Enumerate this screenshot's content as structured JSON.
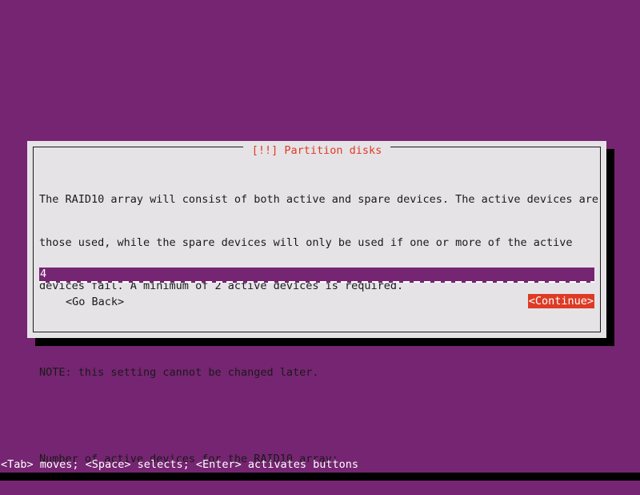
{
  "screen": {
    "background_color": "#762572",
    "accent_color": "#dd3b25",
    "dialog_bg_color": "#e6e3e7",
    "text_color": "#1a1a1a",
    "input_bg_color": "#762572",
    "input_text_color": "#ffffff"
  },
  "dialog": {
    "title": "[!!] Partition disks",
    "body_lines": [
      "The RAID10 array will consist of both active and spare devices. The active devices are",
      "those used, while the spare devices will only be used if one or more of the active",
      "devices fail. A minimum of 2 active devices is required.",
      "",
      "NOTE: this setting cannot be changed later.",
      "",
      "Number of active devices for the RAID10 array:"
    ],
    "input": {
      "value": "4",
      "placeholder": ""
    },
    "buttons": {
      "go_back": "<Go Back>",
      "continue": "<Continue>"
    }
  },
  "help_bar": {
    "text": "<Tab> moves; <Space> selects; <Enter> activates buttons"
  }
}
